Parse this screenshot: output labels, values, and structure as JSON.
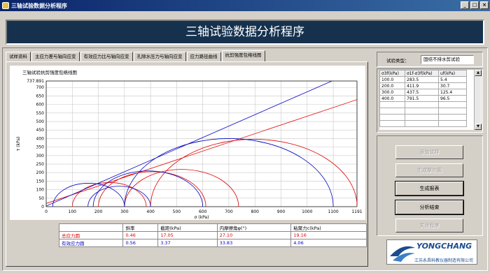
{
  "window": {
    "title": "三轴试验数据分析程序"
  },
  "header": {
    "title": "三轴试验数据分析程序"
  },
  "tabs": [
    {
      "label": "试样资料"
    },
    {
      "label": "主应力差与轴向应变"
    },
    {
      "label": "有效应力比与轴向应变"
    },
    {
      "label": "孔隙水压力与轴向应变"
    },
    {
      "label": "应力路径曲线"
    },
    {
      "label": "抗剪强度包络线图"
    }
  ],
  "colors": {
    "total": "#e00000",
    "effective": "#0000c0",
    "header_bg": "#15314e"
  },
  "chart_data": {
    "type": "line",
    "title": "三轴试验抗剪强度包络线图",
    "xlabel": "σ (kPa)",
    "ylabel": "τ (kPa)",
    "xlim": [
      0,
      1191
    ],
    "ylim": [
      0,
      737.891
    ],
    "xticks": [
      "0",
      "100",
      "200",
      "300",
      "400",
      "500",
      "600",
      "700",
      "800",
      "900",
      "1000",
      "1100",
      "1191"
    ],
    "yticks": [
      "0",
      "50",
      "100",
      "150",
      "200",
      "250",
      "300",
      "350",
      "400",
      "450",
      "500",
      "550",
      "600",
      "650",
      "700",
      "737.891"
    ],
    "grid": true,
    "series": [
      {
        "name": "总应力圆",
        "color": "#e00000",
        "circles": [
          [
            100,
            383.5
          ],
          [
            200,
            611.9
          ],
          [
            300,
            737.5
          ],
          [
            400,
            1191.5
          ]
        ],
        "envelope": {
          "c": 19.16,
          "phi": 27.1
        }
      },
      {
        "name": "有效应力圆",
        "color": "#0000c0",
        "circles": [
          [
            25,
            300
          ],
          [
            160,
            400
          ],
          [
            180,
            600
          ],
          [
            300,
            1100
          ]
        ],
        "envelope": {
          "c": 4.06,
          "phi": 33.83
        }
      }
    ]
  },
  "stats": {
    "headers": [
      "",
      "斜率",
      "截距(kPa)",
      "内摩擦角φ(°)",
      "粘聚力c(kPa)"
    ],
    "rows": [
      {
        "label": "总应力圆",
        "slope": "0.46",
        "intercept": "17.05",
        "phi": "27.10",
        "c": "19.16"
      },
      {
        "label": "有效应力圆",
        "slope": "0.56",
        "intercept": "3.37",
        "phi": "33.83",
        "c": "4.06"
      }
    ]
  },
  "test_type": {
    "label": "试验类型：",
    "value": "固结不排水剪试验"
  },
  "data_table": {
    "headers": [
      "σ3f(kPa)",
      "σ1f-σ3f(kPa)",
      "uf(kPa)"
    ],
    "rows": [
      [
        "100.0",
        "283.5",
        "5.4"
      ],
      [
        "200.0",
        "411.9",
        "30.7"
      ],
      [
        "300.0",
        "437.5",
        "125.4"
      ],
      [
        "400.0",
        "791.5",
        "96.5"
      ]
    ]
  },
  "buttons": {
    "add_sample": "添加试样",
    "gen_mohr": "生成摩尔圆",
    "gen_report": "生成报表",
    "finish": "分析结束",
    "close": "关闭程序"
  },
  "logo": {
    "name": "YONGCHANG",
    "subtitle": "江苏永昌科教仪器制造有限公司"
  }
}
